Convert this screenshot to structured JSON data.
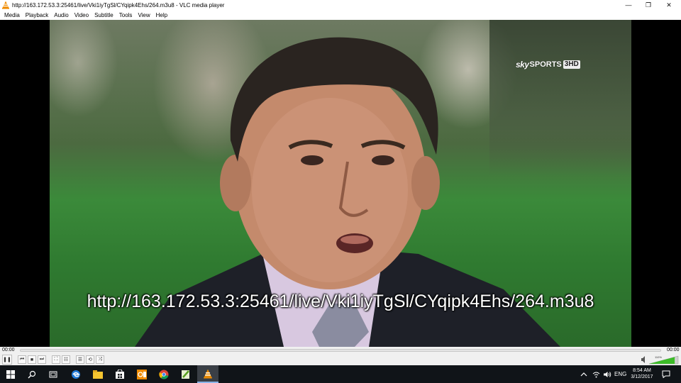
{
  "window": {
    "title": "http://163.172.53.3:25461/live/Vki1iyTgSl/CYqipk4Ehs/264.m3u8 - VLC media player",
    "minimize_glyph": "—",
    "maximize_glyph": "❐",
    "close_glyph": "✕"
  },
  "menu": [
    "Media",
    "Playback",
    "Audio",
    "Video",
    "Subtitle",
    "Tools",
    "View",
    "Help"
  ],
  "video": {
    "channel_logo": {
      "sky": "sky",
      "sports": "SPORTS",
      "channel": "3HD"
    },
    "overlay_text": "http://163.172.53.3:25461/live/Vki1iyTgSl/CYqipk4Ehs/264.m3u8"
  },
  "seek": {
    "elapsed": "00:00",
    "remaining": "00:00",
    "progress": 0
  },
  "controls": {
    "pause": "❚❚",
    "previous": "⏮",
    "stop": "■",
    "next": "⏭",
    "fullscreen": "⛶",
    "extended": "☷",
    "playlist": "☰",
    "loop": "⟲",
    "random": "⤨"
  },
  "volume": {
    "label": "110%",
    "level": 1.1
  },
  "taskbar": {
    "start_icon": "windows-logo-icon",
    "search_icon": "search-icon",
    "task_view_icon": "task-view-icon",
    "apps": [
      "edge-icon",
      "file-explorer-icon",
      "store-icon",
      "outlook-icon",
      "chrome-icon",
      "notepadpp-icon",
      "vlc-icon"
    ],
    "tray": {
      "language": "ENG"
    },
    "clock": {
      "time": "8:54 AM",
      "date": "3/12/2017"
    }
  },
  "colors": {
    "vlc_orange": "#f08c00",
    "taskbar_bg": "#101418",
    "accent": "#8ab4e8"
  }
}
